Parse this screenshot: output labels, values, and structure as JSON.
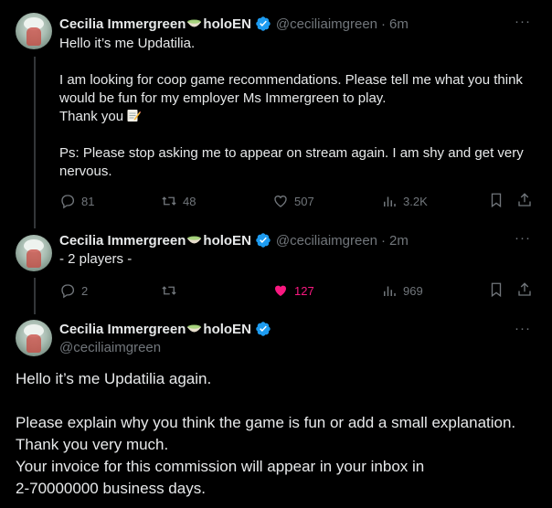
{
  "colors": {
    "background": "#000000",
    "text": "#e7e9ea",
    "muted": "#71767b",
    "verified": "#1d9bf0",
    "like": "#f91880",
    "thread_line": "#333639"
  },
  "tweets": [
    {
      "name": "Cecilia Immergreen",
      "name_suffix": "holoEN",
      "handle": "@ceciliaimgreen",
      "separator": "·",
      "time": "6m",
      "more": "···",
      "text": "Hello it’s me Updatilia.\n\nI am looking for coop game recommendations. Please tell me what you think would be fun for my employer Ms Immergreen to play.\nThank you",
      "text_emoji": "memo-icon",
      "text_after": "\n\nPs: Please stop asking me to appear on stream again. I am shy and get very nervous.",
      "replies": "81",
      "reposts": "48",
      "likes": "507",
      "views": "3.2K",
      "liked": false
    },
    {
      "name": "Cecilia Immergreen",
      "name_suffix": "holoEN",
      "handle": "@ceciliaimgreen",
      "separator": "·",
      "time": "2m",
      "more": "···",
      "text": "- 2 players -",
      "replies": "2",
      "reposts": "",
      "likes": "127",
      "views": "969",
      "liked": true
    },
    {
      "name": "Cecilia Immergreen",
      "name_suffix": "holoEN",
      "handle": "@ceciliaimgreen",
      "more": "···",
      "text": "Hello it’s me Updatilia again.\n\nPlease explain why you think the game is fun or add a small explanation.\nThank you very much.\nYour invoice for this commission will appear in your inbox in\n2-70000000 business days."
    }
  ]
}
